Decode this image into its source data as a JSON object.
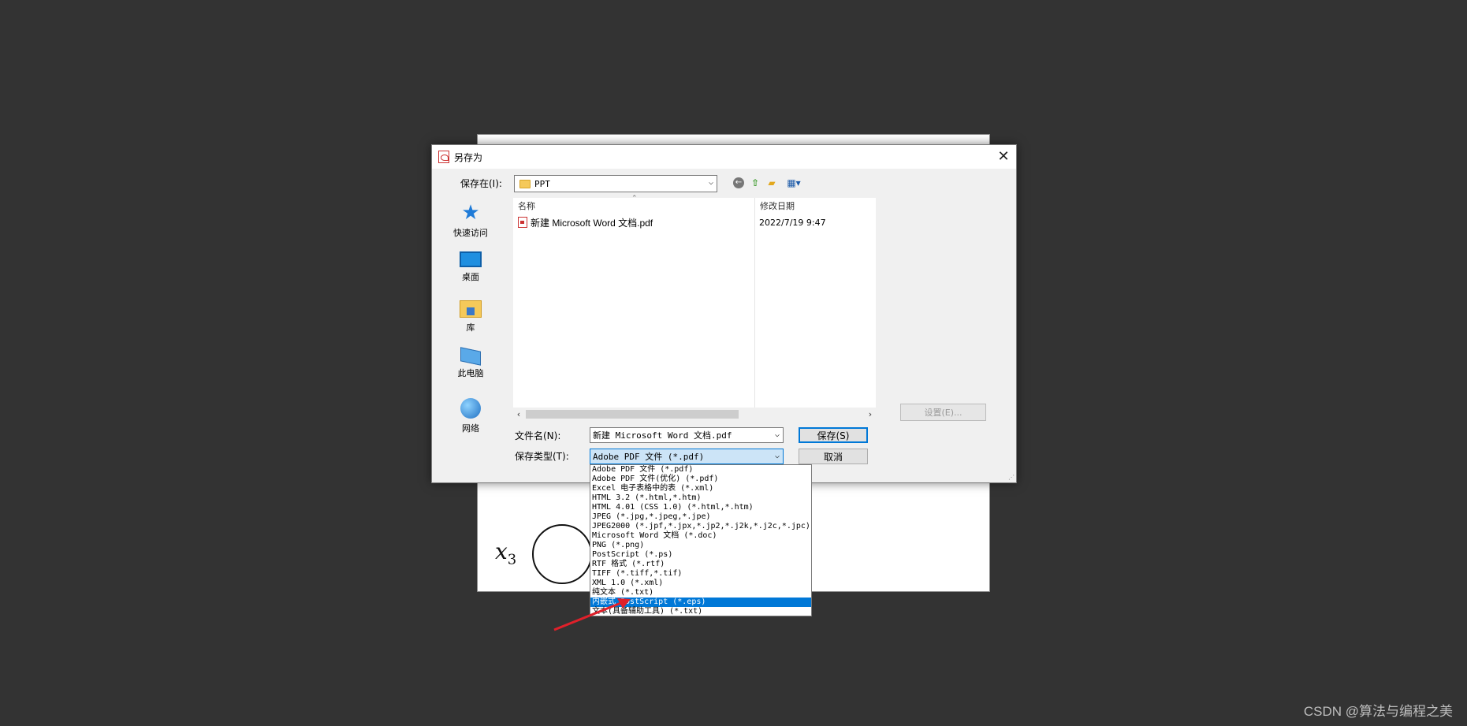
{
  "background_doc": {
    "variable": "x",
    "subscript": "3"
  },
  "dialog": {
    "title": "另存为",
    "close_label": "✕",
    "save_in_label": "保存在(I):",
    "save_in_value": "PPT",
    "places": [
      {
        "label": "快速访问",
        "icon": "star-icon"
      },
      {
        "label": "桌面",
        "icon": "desktop-icon"
      },
      {
        "label": "库",
        "icon": "library-icon"
      },
      {
        "label": "此电脑",
        "icon": "computer-icon"
      },
      {
        "label": "网络",
        "icon": "network-icon"
      }
    ],
    "columns": {
      "name": "名称",
      "date": "修改日期"
    },
    "files": [
      {
        "name": "新建 Microsoft Word 文档.pdf",
        "date": "2022/7/19 9:47"
      }
    ],
    "settings_label": "设置(E)...",
    "filename_label": "文件名(N):",
    "filename_value": "新建 Microsoft Word 文档.pdf",
    "filetype_label": "保存类型(T):",
    "filetype_value": "Adobe PDF 文件 (*.pdf)",
    "save_label": "保存(S)",
    "cancel_label": "取消"
  },
  "dropdown": {
    "options": [
      "Adobe PDF 文件 (*.pdf)",
      "Adobe PDF 文件(优化) (*.pdf)",
      "Excel 电子表格中的表 (*.xml)",
      "HTML 3.2 (*.html,*.htm)",
      "HTML 4.01 (CSS 1.0) (*.html,*.htm)",
      "JPEG (*.jpg,*.jpeg,*.jpe)",
      "JPEG2000 (*.jpf,*.jpx,*.jp2,*.j2k,*.j2c,*.jpc)",
      "Microsoft Word 文档 (*.doc)",
      "PNG (*.png)",
      "PostScript (*.ps)",
      "RTF 格式 (*.rtf)",
      "TIFF (*.tiff,*.tif)",
      "XML 1.0 (*.xml)",
      "纯文本 (*.txt)",
      "内嵌式 PostScript (*.eps)",
      "文本(具备辅助工具) (*.txt)"
    ],
    "selected_option": "内嵌式 PostScript (*.eps)"
  },
  "annotation": {
    "color": "#e0202a"
  },
  "watermark": "CSDN @算法与编程之美",
  "colors": {
    "accent": "#0078d7",
    "selection": "#0078d7",
    "background": "#333333"
  }
}
